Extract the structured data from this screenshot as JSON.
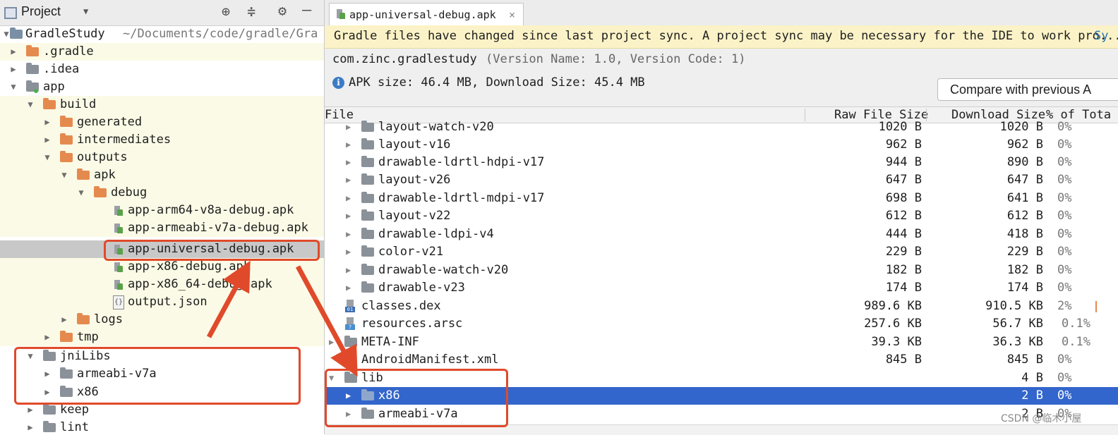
{
  "left_panel": {
    "title": "Project",
    "tree": [
      {
        "label": "GradleStudy",
        "path": "~/Documents/code/gradle/Gra",
        "icon": "module-folder-icon",
        "arrow": "▼"
      },
      {
        "label": ".gradle",
        "icon": "folder-icon",
        "arrow": "▶"
      },
      {
        "label": ".idea",
        "icon": "folder-icon",
        "arrow": "▶"
      },
      {
        "label": "app",
        "icon": "module-folder-icon",
        "arrow": "▼"
      },
      {
        "label": "build",
        "icon": "folder-icon",
        "arrow": "▼"
      },
      {
        "label": "generated",
        "icon": "folder-icon",
        "arrow": "▶"
      },
      {
        "label": "intermediates",
        "icon": "folder-icon",
        "arrow": "▶"
      },
      {
        "label": "outputs",
        "icon": "folder-icon",
        "arrow": "▼"
      },
      {
        "label": "apk",
        "icon": "folder-icon",
        "arrow": "▼"
      },
      {
        "label": "debug",
        "icon": "folder-icon",
        "arrow": "▼"
      },
      {
        "label": "app-arm64-v8a-debug.apk",
        "icon": "apk-file-icon"
      },
      {
        "label": "app-armeabi-v7a-debug.apk",
        "icon": "apk-file-icon"
      },
      {
        "label": "app-universal-debug.apk",
        "icon": "apk-file-icon"
      },
      {
        "label": "app-x86-debug.apk",
        "icon": "apk-file-icon"
      },
      {
        "label": "app-x86_64-debug.apk",
        "icon": "apk-file-icon"
      },
      {
        "label": "output.json",
        "icon": "json-file-icon"
      },
      {
        "label": "logs",
        "icon": "folder-icon",
        "arrow": "▶"
      },
      {
        "label": "tmp",
        "icon": "folder-icon",
        "arrow": "▶"
      },
      {
        "label": "jniLibs",
        "icon": "folder-icon",
        "arrow": "▼"
      },
      {
        "label": "armeabi-v7a",
        "icon": "folder-icon",
        "arrow": "▶"
      },
      {
        "label": "x86",
        "icon": "folder-icon",
        "arrow": "▶"
      },
      {
        "label": "keep",
        "icon": "folder-icon",
        "arrow": "▶"
      },
      {
        "label": "lint",
        "icon": "folder-icon",
        "arrow": "▶"
      }
    ]
  },
  "editor": {
    "tab_label": "app-universal-debug.apk",
    "banner": "Gradle files have changed since last project sync. A project sync may be necessary for the IDE to work pro...",
    "banner_link": "Sy",
    "package_name": "com.zinc.gradlestudy",
    "version_info": "(Version Name: 1.0, Version Code: 1)",
    "apk_size": "APK size: 46.4 MB, Download Size: 45.4 MB",
    "compare_button": "Compare with previous A",
    "columns": {
      "file": "File",
      "raw": "Raw File Size",
      "download": "Download Size",
      "percent": "% of Tota"
    },
    "rows": [
      {
        "name": "layout-watch-v20",
        "raw": "1020 B",
        "dl": "1020 B",
        "pct": "0%"
      },
      {
        "name": "layout-v16",
        "raw": "962 B",
        "dl": "962 B",
        "pct": "0%"
      },
      {
        "name": "drawable-ldrtl-hdpi-v17",
        "raw": "944 B",
        "dl": "890 B",
        "pct": "0%"
      },
      {
        "name": "layout-v26",
        "raw": "647 B",
        "dl": "647 B",
        "pct": "0%"
      },
      {
        "name": "drawable-ldrtl-mdpi-v17",
        "raw": "698 B",
        "dl": "641 B",
        "pct": "0%"
      },
      {
        "name": "layout-v22",
        "raw": "612 B",
        "dl": "612 B",
        "pct": "0%"
      },
      {
        "name": "drawable-ldpi-v4",
        "raw": "444 B",
        "dl": "418 B",
        "pct": "0%"
      },
      {
        "name": "color-v21",
        "raw": "229 B",
        "dl": "229 B",
        "pct": "0%"
      },
      {
        "name": "drawable-watch-v20",
        "raw": "182 B",
        "dl": "182 B",
        "pct": "0%"
      },
      {
        "name": "drawable-v23",
        "raw": "174 B",
        "dl": "174 B",
        "pct": "0%"
      },
      {
        "name": "classes.dex",
        "raw": "989.6 KB",
        "dl": "910.5 KB",
        "pct": "2%"
      },
      {
        "name": "resources.arsc",
        "raw": "257.6 KB",
        "dl": "56.7 KB",
        "pct": "0.1%"
      },
      {
        "name": "META-INF",
        "raw": "39.3 KB",
        "dl": "36.3 KB",
        "pct": "0.1%"
      },
      {
        "name": "AndroidManifest.xml",
        "raw": "845 B",
        "dl": "845 B",
        "pct": "0%"
      },
      {
        "name": "lib",
        "raw": "",
        "dl": "4 B",
        "pct": "0%"
      },
      {
        "name": "x86",
        "raw": "",
        "dl": "2 B",
        "pct": "0%"
      },
      {
        "name": "armeabi-v7a",
        "raw": "",
        "dl": "2 B",
        "pct": "0%"
      }
    ]
  },
  "watermark": "CSDN @临木小屋",
  "colors": {
    "annotation": "#e04a2a",
    "selection": "#3366cc",
    "banner_bg": "#fbf3c7"
  }
}
